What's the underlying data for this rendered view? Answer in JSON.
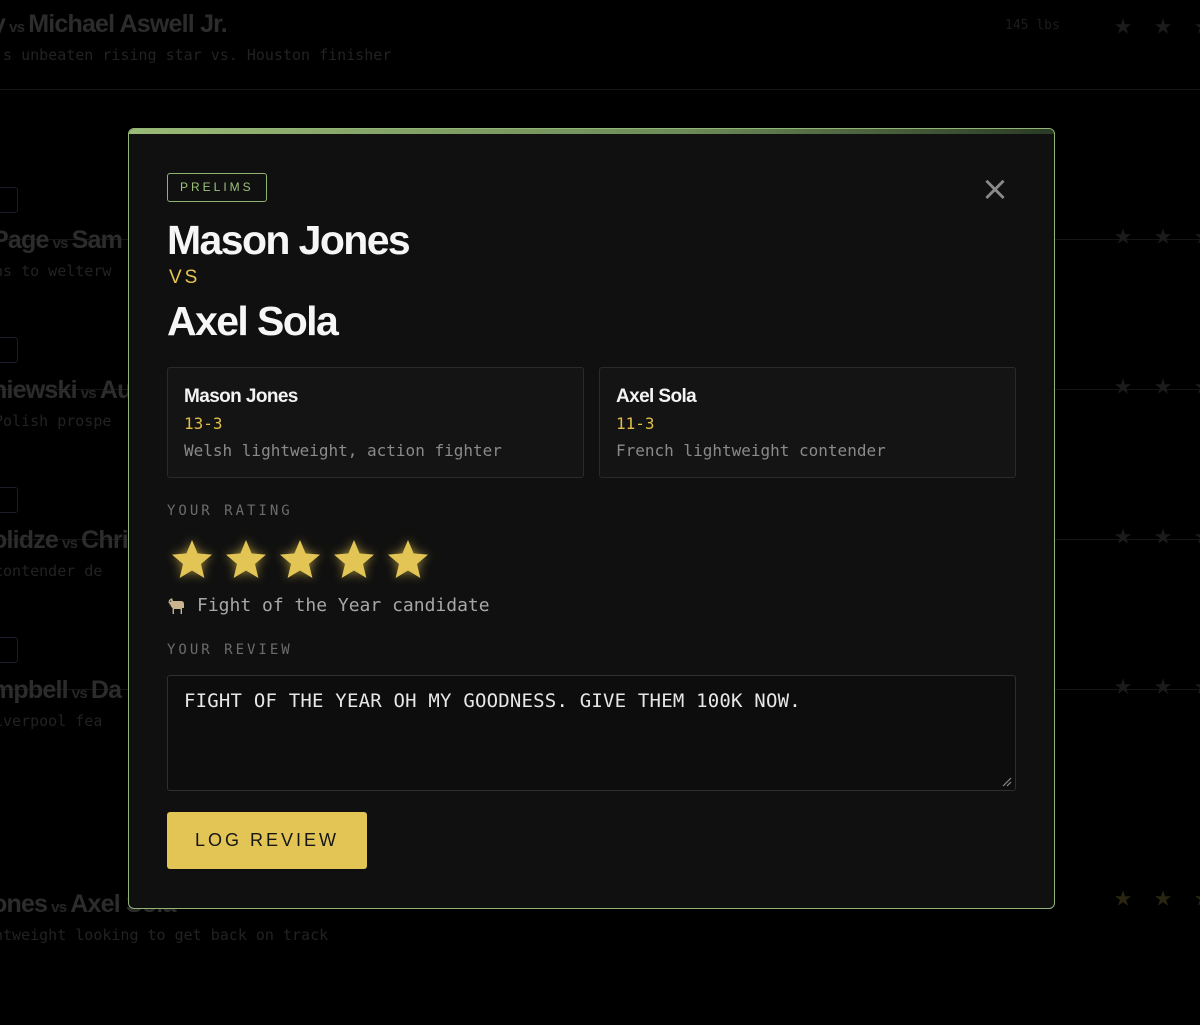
{
  "background": {
    "rows": [
      {
        "fighter_a": "y",
        "vs": "vs",
        "fighter_b": "Michael Aswell Jr.",
        "desc": "'s unbeaten rising star vs. Houston finisher",
        "meta": "145 lbs"
      },
      {
        "fighter_a": "Page",
        "vs": "vs",
        "fighter_b": "Sam I",
        "desc": "ns to welterw"
      },
      {
        "fighter_a": "niewski",
        "vs": "vs",
        "fighter_b": "Au",
        "desc": "Polish prospe"
      },
      {
        "fighter_a": "olidze",
        "vs": "vs",
        "fighter_b": "Chri",
        "desc": " contender de"
      },
      {
        "fighter_a": "mpbell",
        "vs": "vs",
        "fighter_b": "Da",
        "desc": "iverpool fea"
      },
      {
        "fighter_a": "ones",
        "vs": "vs",
        "fighter_b": "Axel Sola",
        "desc": "ntweight looking to get back on track"
      }
    ]
  },
  "modal": {
    "badge": "PRELIMS",
    "close_glyph": "×",
    "fighter_a": "Mason Jones",
    "vs_label": "VS",
    "fighter_b": "Axel Sola",
    "cards": [
      {
        "name": "Mason Jones",
        "record": "13-3",
        "desc": "Welsh lightweight, action fighter"
      },
      {
        "name": "Axel Sola",
        "record": "11-3",
        "desc": "French lightweight contender"
      }
    ],
    "rating_label": "YOUR RATING",
    "rating": 5,
    "rating_max": 5,
    "rating_caption": "Fight of the Year candidate",
    "rating_icon": "goat-icon",
    "review_label": "YOUR REVIEW",
    "review_text": "FIGHT OF THE YEAR OH MY GOODNESS. GIVE THEM 100K NOW.",
    "submit_label": "LOG REVIEW"
  },
  "colors": {
    "accent_green": "#93b477",
    "accent_gold": "#e3c556",
    "background": "#000000",
    "modal_bg": "#101010"
  }
}
